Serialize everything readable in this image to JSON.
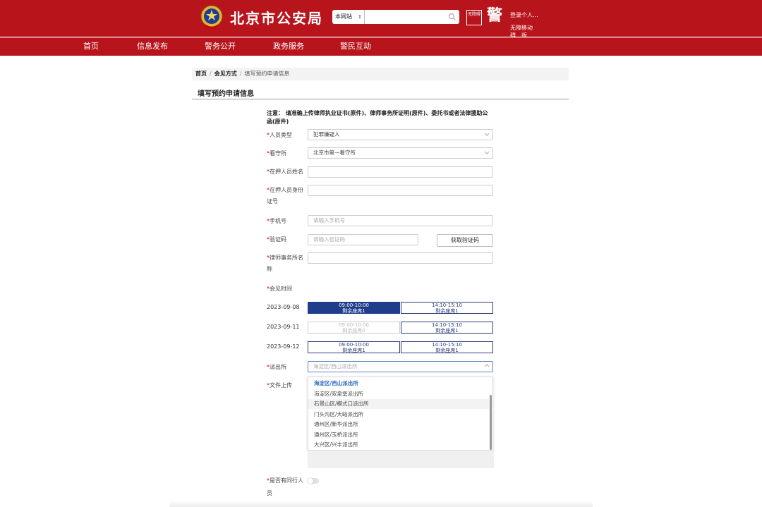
{
  "header": {
    "site_title": "北京市公安局",
    "search": {
      "scope": "本网站",
      "placeholder": ""
    },
    "logo_text": "无障碍",
    "logo_char": "警",
    "login_label": "登录个人...",
    "barrier_label_line1": "无障移动",
    "barrier_label_line2": "碍　版"
  },
  "nav": {
    "items": [
      "首页",
      "信息发布",
      "警务公开",
      "政务服务",
      "警民互动"
    ]
  },
  "breadcrumb": {
    "items": [
      "首页",
      "会见方式",
      "填写预约申请信息"
    ]
  },
  "page_title": "填写预约申请信息",
  "form": {
    "notice": "注意：  请准确上传律师执业证书(原件)、律师事务所证明(原件)、委托书或者法律援助公函(原件)",
    "required_mark": "*",
    "person_type": {
      "label": "人员类型",
      "value": "犯罪嫌疑人"
    },
    "detention_center": {
      "label": "看守所",
      "value": "北京市第一看守所"
    },
    "detainee_name": {
      "label": "在押人员姓名",
      "value": ""
    },
    "detainee_id": {
      "label": "在押人员身份证号",
      "value": ""
    },
    "phone": {
      "label": "手机号",
      "placeholder": "请输入手机号"
    },
    "verification_code": {
      "label": "验证码",
      "placeholder": "请输入验证码",
      "button": "获取验证码"
    },
    "law_firm": {
      "label": "律师事务所名称",
      "value": ""
    },
    "meeting_time": {
      "label": "会见时间",
      "days": [
        {
          "date": "2023-09-08",
          "slots": [
            {
              "time": "09:00-10:00",
              "remaining": "剩余座席1",
              "state": "selected"
            },
            {
              "time": "14:10-15:10",
              "remaining": "剩余座席1",
              "state": "available"
            }
          ]
        },
        {
          "date": "2023-09-11",
          "slots": [
            {
              "time": "09:00-10:00",
              "remaining": "剩余座席0",
              "state": "disabled"
            },
            {
              "time": "14:10-15:10",
              "remaining": "剩余座席1",
              "state": "available"
            }
          ]
        },
        {
          "date": "2023-09-12",
          "slots": [
            {
              "time": "09:00-10:00",
              "remaining": "剩余座席1",
              "state": "available"
            },
            {
              "time": "14:10-15:10",
              "remaining": "剩余座席1",
              "state": "available"
            }
          ]
        }
      ]
    },
    "police_station": {
      "label": "派出所",
      "placeholder": "海淀区/西山派出所",
      "options": [
        "海淀区/西山派出所",
        "海淀区/双泉堡派出所",
        "石景山区/模式口派出所",
        "门头沟区/大峪派出所",
        "通州区/新华派出所",
        "通州区/玉桥派出所",
        "大兴区/兴丰派出所"
      ],
      "active_index": 0,
      "hover_index": 2
    },
    "file_upload": {
      "label": "文件上传"
    },
    "companion": {
      "label": "是否有同行人员",
      "enabled": false
    }
  }
}
